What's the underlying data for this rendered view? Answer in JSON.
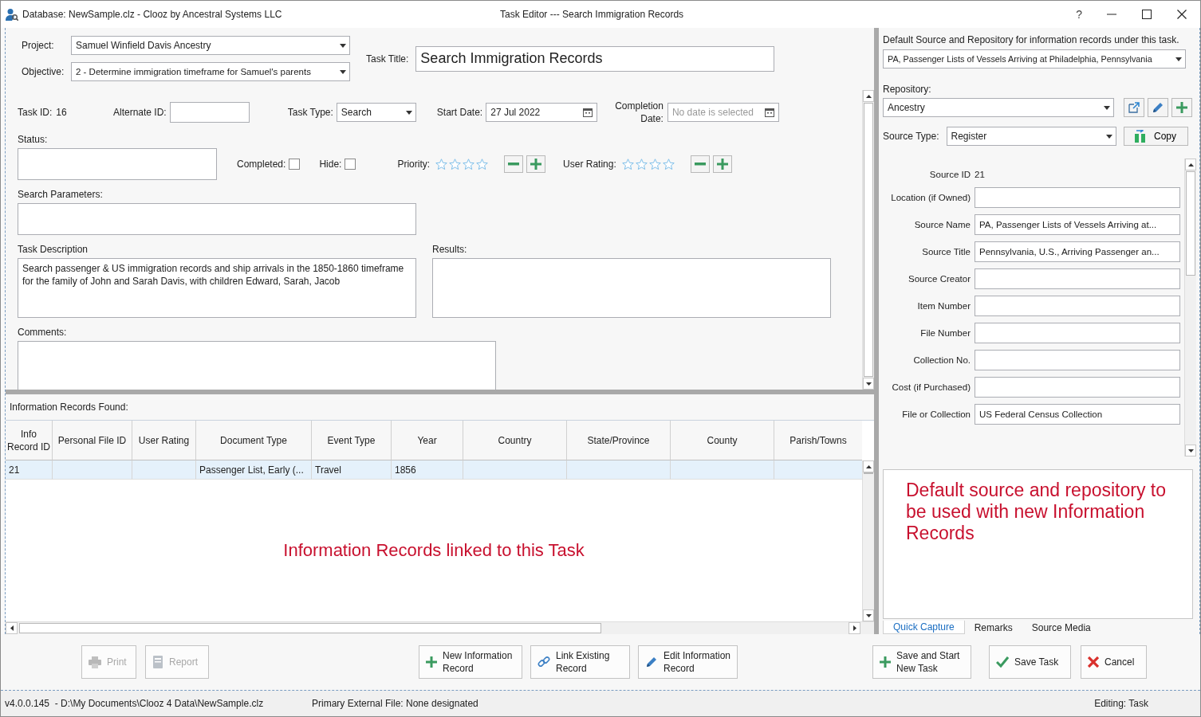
{
  "window": {
    "database": "Database: NewSample.clz - Clooz by Ancestral Systems LLC",
    "title": "Task Editor --- Search Immigration Records",
    "help": "?"
  },
  "task": {
    "project": {
      "label": "Project:",
      "value": "Samuel Winfield Davis Ancestry"
    },
    "objective": {
      "label": "Objective:",
      "value": "2 - Determine immigration timeframe for Samuel's parents"
    },
    "task_title": {
      "label": "Task Title:",
      "value": "Search Immigration Records"
    },
    "task_id": {
      "label": "Task ID:",
      "value": "16"
    },
    "alternate_id": {
      "label": "Alternate ID:"
    },
    "task_type": {
      "label": "Task Type:",
      "value": "Search"
    },
    "start_date": {
      "label": "Start Date:",
      "value": "27 Jul 2022"
    },
    "completion_date": {
      "label": "Completion\nDate:",
      "placeholder": "No date is selected"
    },
    "status": {
      "label": "Status:"
    },
    "completed": {
      "label": "Completed:",
      "checked": false
    },
    "hide": {
      "label": "Hide:",
      "checked": false
    },
    "priority": {
      "label": "Priority:",
      "stars": 0
    },
    "user_rating": {
      "label": "User Rating:",
      "stars": 0
    },
    "search_parameters": {
      "label": "Search Parameters:"
    },
    "task_description": {
      "label": "Task Description",
      "value": "Search passenger & US immigration records and ship arrivals in the 1850-1860 timeframe for the family of John and Sarah Davis, with children Edward, Sarah, Jacob"
    },
    "results": {
      "label": "Results:"
    },
    "comments": {
      "label": "Comments:"
    }
  },
  "records": {
    "title": "Information Records Found:",
    "columns": [
      "Info Record ID",
      "Personal File ID",
      "User Rating",
      "Document Type",
      "Event Type",
      "Year",
      "Country",
      "State/Province",
      "County",
      "Parish/Towns"
    ],
    "rows": [
      {
        "selected": true,
        "cells": [
          "21",
          null,
          null,
          "Passenger List, Early (...",
          "Travel",
          "1856",
          null,
          null,
          null,
          null
        ]
      }
    ],
    "annotation": "Information Records linked to this Task"
  },
  "source": {
    "default_label": "Default Source and Repository for information records under this task.",
    "default_value": "PA, Passenger Lists of Vessels Arriving at Philadelphia, Pennsylvania",
    "repository": {
      "label": "Repository:",
      "value": "Ancestry"
    },
    "source_type": {
      "label": "Source Type:",
      "value": "Register"
    },
    "copy_button": "Copy",
    "source_id": {
      "label": "Source ID",
      "value": "21"
    },
    "fields": [
      {
        "label": "Location (if Owned)"
      },
      {
        "label": "Source Name",
        "value": "PA, Passenger Lists of Vessels Arriving at..."
      },
      {
        "label": "Source Title",
        "value": "Pennsylvania, U.S., Arriving Passenger an..."
      },
      {
        "label": "Source Creator"
      },
      {
        "label": "Item Number"
      },
      {
        "label": "File Number"
      },
      {
        "label": "Collection No."
      },
      {
        "label": "Cost (if Purchased)"
      },
      {
        "label": "File or Collection",
        "value": "US Federal Census Collection"
      }
    ],
    "annotation": "Default source and repository to be used with new Information Records",
    "tabs": [
      {
        "label": "Quick Capture",
        "selected": true
      },
      {
        "label": "Remarks",
        "selected": false
      },
      {
        "label": "Source Media",
        "selected": false
      }
    ]
  },
  "actions": [
    {
      "kind": "print",
      "label": "Print",
      "disabled": true
    },
    {
      "kind": "report",
      "label": "Report",
      "disabled": true
    },
    {
      "kind": "add",
      "label": "New Information\nRecord",
      "disabled": false
    },
    {
      "kind": "link",
      "label": "Link Existing\nRecord",
      "disabled": false
    },
    {
      "kind": "edit",
      "label": "Edit Information\nRecord",
      "disabled": false
    },
    {
      "kind": "add",
      "label": "Save and Start\nNew Task",
      "disabled": false
    },
    {
      "kind": "save",
      "label": "Save Task",
      "disabled": false
    },
    {
      "kind": "cancel",
      "label": "Cancel",
      "disabled": false
    }
  ],
  "status_bar": {
    "path": "v4.0.0.145  - D:\\My Documents\\Clooz 4 Data\\NewSample.clz",
    "external_file": "Primary External File: None designated",
    "mode": "Editing: Task"
  }
}
